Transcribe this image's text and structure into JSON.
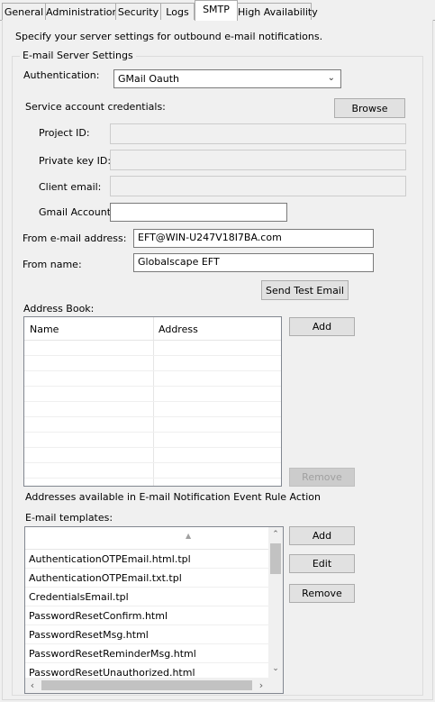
{
  "tabs": [
    {
      "label": "General"
    },
    {
      "label": "Administration"
    },
    {
      "label": "Security"
    },
    {
      "label": "Logs"
    },
    {
      "label": "SMTP"
    },
    {
      "label": "High Availability"
    }
  ],
  "description": "Specify your server settings for outbound e-mail notifications.",
  "email_server": {
    "group_title": "E-mail Server Settings",
    "auth_label": "Authentication:",
    "auth_value": "GMail Oauth",
    "service_creds_label": "Service account credentials:",
    "browse_label": "Browse",
    "project_id_label": "Project ID:",
    "private_key_label": "Private key ID:",
    "client_email_label": "Client email:",
    "gmail_account_label": "Gmail Account:",
    "gmail_account_value": ""
  },
  "from_email_label": "From e-mail address:",
  "from_email_value": "EFT@WIN-U247V18I7BA.com",
  "from_name_label": "From name:",
  "from_name_value": "Globalscape EFT",
  "send_test_label": "Send Test Email",
  "address_book": {
    "label": "Address Book:",
    "columns": [
      "Name",
      "Address"
    ],
    "add_label": "Add",
    "remove_label": "Remove",
    "note": "Addresses available in E-mail Notification Event Rule Action"
  },
  "templates": {
    "label": "E-mail templates:",
    "items": [
      "AuthenticationOTPEmail.html.tpl",
      "AuthenticationOTPEmail.txt.tpl",
      "CredentialsEmail.tpl",
      "PasswordResetConfirm.html",
      "PasswordResetMsg.html",
      "PasswordResetReminderMsg.html",
      "PasswordResetUnauthorized.html"
    ],
    "add_label": "Add",
    "edit_label": "Edit",
    "remove_label": "Remove"
  }
}
